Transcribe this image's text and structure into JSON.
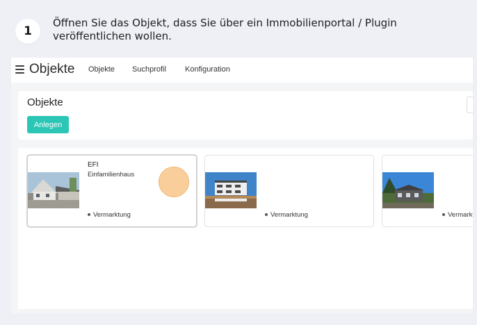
{
  "step": {
    "number": "1",
    "instruction": "Öffnen Sie das Objekt, dass Sie über ein Immobilienportal / Plugin veröffentlichen wollen."
  },
  "topbar": {
    "brand": "Objekte",
    "nav": [
      "Objekte",
      "Suchprofil",
      "Konfiguration"
    ]
  },
  "panel": {
    "title": "Objekte",
    "add_button": "Anlegen"
  },
  "cards": [
    {
      "title": "EFI",
      "subtitle": "Einfamilienhaus",
      "status": "Vermarktung"
    },
    {
      "title": "",
      "subtitle": "",
      "status": "Vermarktung"
    },
    {
      "title": "",
      "subtitle": "",
      "status": "Vermarkt"
    }
  ],
  "colors": {
    "accent": "#2cc6b6",
    "click_marker": "#f7be78",
    "background": "#eef0f6"
  }
}
